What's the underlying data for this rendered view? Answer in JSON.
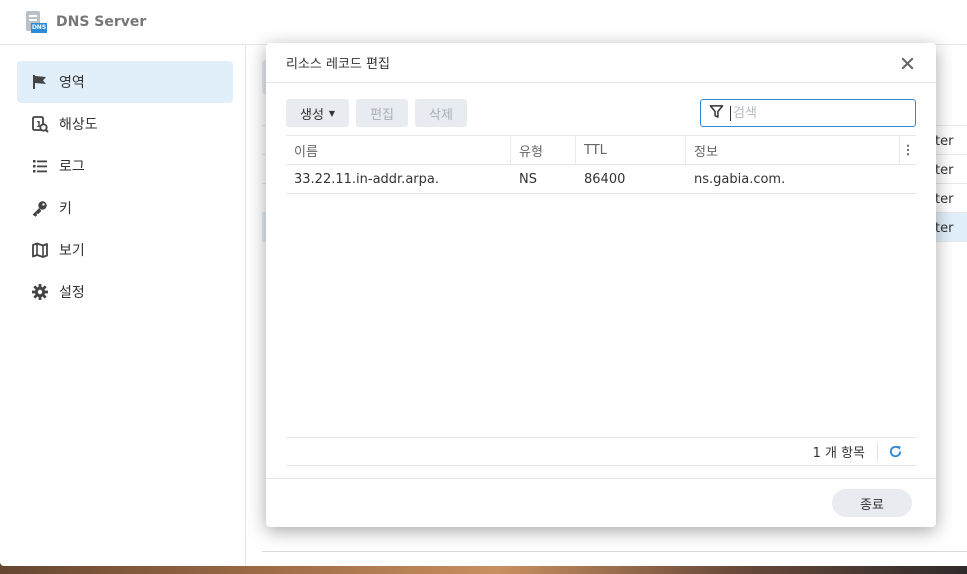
{
  "app": {
    "title": "DNS Server",
    "icon_tag": "DNS"
  },
  "sidebar": {
    "items": [
      {
        "label": "영역",
        "icon": "flag-icon",
        "active": true
      },
      {
        "label": "해상도",
        "icon": "resolution-icon",
        "active": false
      },
      {
        "label": "로그",
        "icon": "list-icon",
        "active": false
      },
      {
        "label": "키",
        "icon": "key-icon",
        "active": false
      },
      {
        "label": "보기",
        "icon": "map-icon",
        "active": false
      },
      {
        "label": "설정",
        "icon": "gear-icon",
        "active": false
      }
    ]
  },
  "background": {
    "cells": [
      "ter",
      "ter",
      "ter",
      "ter"
    ]
  },
  "dialog": {
    "title": "리소스 레코드 편집",
    "toolbar": {
      "create_label": "생성",
      "edit_label": "편집",
      "delete_label": "삭제"
    },
    "search": {
      "placeholder": "검색",
      "value": ""
    },
    "columns": [
      "이름",
      "유형",
      "TTL",
      "정보"
    ],
    "rows": [
      {
        "name": "33.22.11.in-addr.arpa.",
        "type": "NS",
        "ttl": "86400",
        "info": "ns.gabia.com."
      }
    ],
    "footer_count": "1 개 항목",
    "close_label": "종료"
  },
  "colors": {
    "accent": "#2f8bd8",
    "active_nav": "#e1effb"
  }
}
